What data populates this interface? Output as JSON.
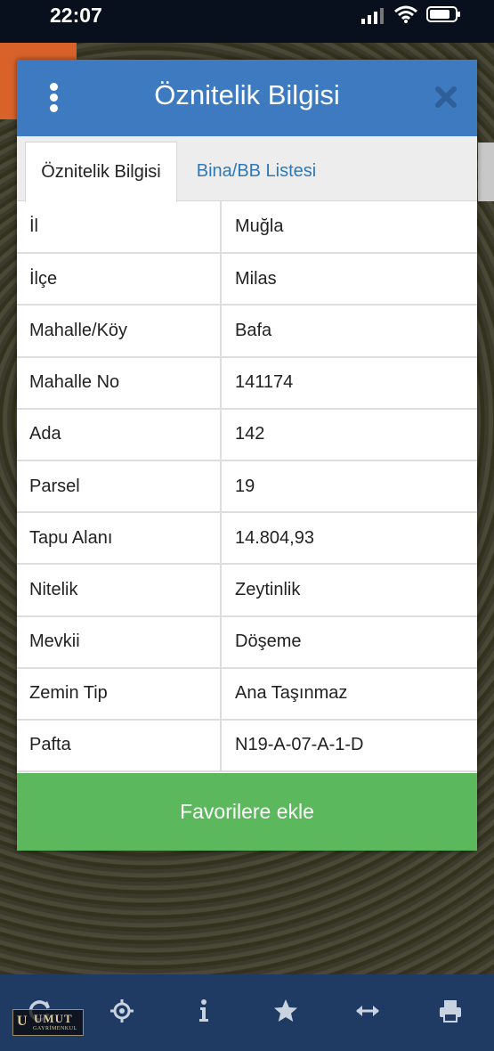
{
  "status_bar": {
    "time": "22:07"
  },
  "dialog": {
    "title": "Öznitelik Bilgisi",
    "tabs": [
      {
        "label": "Öznitelik Bilgisi",
        "active": true
      },
      {
        "label": "Bina/BB Listesi",
        "active": false
      }
    ],
    "rows": [
      {
        "key": "İl",
        "value": "Muğla"
      },
      {
        "key": "İlçe",
        "value": "Milas"
      },
      {
        "key": "Mahalle/Köy",
        "value": "Bafa"
      },
      {
        "key": "Mahalle No",
        "value": "141174"
      },
      {
        "key": "Ada",
        "value": "142"
      },
      {
        "key": "Parsel",
        "value": "19"
      },
      {
        "key": "Tapu Alanı",
        "value": "14.804,93"
      },
      {
        "key": "Nitelik",
        "value": "Zeytinlik"
      },
      {
        "key": "Mevkii",
        "value": "Döşeme"
      },
      {
        "key": "Zemin Tip",
        "value": "Ana Taşınmaz"
      },
      {
        "key": "Pafta",
        "value": "N19-A-07-A-1-D"
      }
    ],
    "favorite_button_label": "Favorilere ekle"
  },
  "toolbar": {
    "icons": [
      "refresh-icon",
      "locate-icon",
      "info-icon",
      "star-icon",
      "measure-icon",
      "print-icon"
    ]
  },
  "logo": {
    "name": "UMUT",
    "subtitle": "GAYRİMENKUL"
  },
  "colors": {
    "header": "#3e7ac0",
    "button": "#5cb85c",
    "toolbar": "#1f3b63",
    "tab_link": "#2f78b7"
  }
}
